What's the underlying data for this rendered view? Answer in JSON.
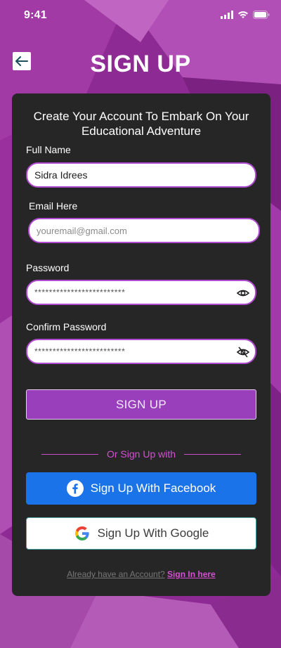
{
  "status": {
    "time": "9:41"
  },
  "page": {
    "title": "SIGN UP"
  },
  "card": {
    "subtitle": "Create Your Account To Embark On Your Educational Adventure"
  },
  "form": {
    "full_name": {
      "label": "Full Name",
      "value": "Sidra Idrees"
    },
    "email": {
      "label": "Email Here",
      "placeholder": "youremail@gmail.com"
    },
    "password": {
      "label": "Password",
      "value": "*************************"
    },
    "confirm_password": {
      "label": "Confirm Password",
      "value": "*************************"
    }
  },
  "buttons": {
    "signup": "SIGN UP",
    "facebook": "Sign Up With Facebook",
    "google": "Sign Up With Google"
  },
  "divider": {
    "text": "Or Sign Up with"
  },
  "footer": {
    "prompt": "Already have an  Account?",
    "link": "Sign In here"
  },
  "colors": {
    "background": "#8e2a93",
    "card": "#262626",
    "accent": "#b04ad0",
    "signup_button": "#9a3fbc",
    "facebook": "#1a73e8",
    "link": "#d64fd6"
  }
}
